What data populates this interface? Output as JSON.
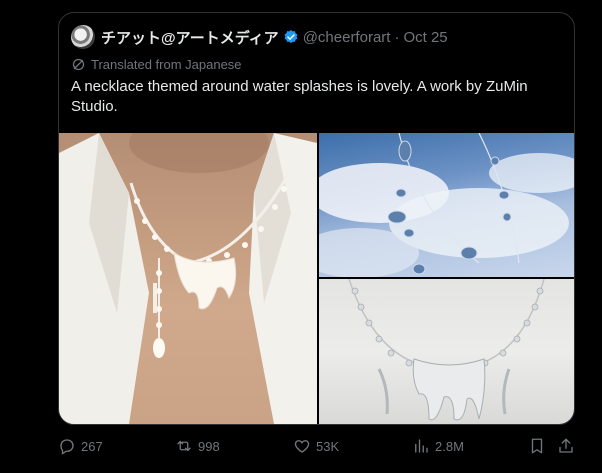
{
  "post": {
    "author_name": "チアット@アートメディア",
    "handle": "@cheerforart",
    "separator": "·",
    "date": "Oct 25",
    "translated_label": "Translated from Japanese",
    "text": "A necklace themed around water splashes is lovely. A work by ZuMin Studio.",
    "images": [
      {
        "description_icon": "photo-necklace-worn"
      },
      {
        "description_icon": "photo-necklace-sky"
      },
      {
        "description_icon": "photo-necklace-white"
      }
    ]
  },
  "actions": {
    "replies": "267",
    "reposts": "998",
    "likes": "53K",
    "views": "2.8M"
  },
  "colors": {
    "background": "#000000",
    "text_primary": "#e7e9ea",
    "text_secondary": "#71767b",
    "verified": "#1d9bf0",
    "border": "#2f3336"
  }
}
